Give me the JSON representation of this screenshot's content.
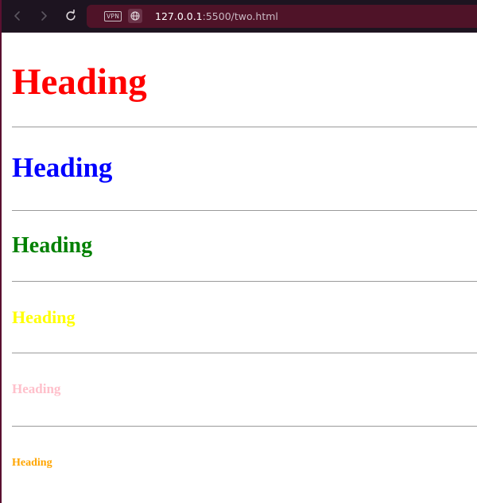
{
  "browser": {
    "vpn_label": "VPN",
    "url_host": "127.0.0.1",
    "url_rest": ":5500/two.html",
    "icons": [
      "back-arrow-icon",
      "forward-arrow-icon",
      "reload-icon",
      "globe-icon"
    ]
  },
  "page": {
    "headings": [
      {
        "text": "Heading",
        "color": "#ff0000",
        "level": 1
      },
      {
        "text": "Heading",
        "color": "#0000ff",
        "level": 2
      },
      {
        "text": "Heading",
        "color": "#008000",
        "level": 3
      },
      {
        "text": "Heading",
        "color": "#ffff00",
        "level": 4
      },
      {
        "text": "Heading",
        "color": "#ffc0cb",
        "level": 5
      },
      {
        "text": "Heading",
        "color": "#ffa500",
        "level": 6
      }
    ]
  }
}
